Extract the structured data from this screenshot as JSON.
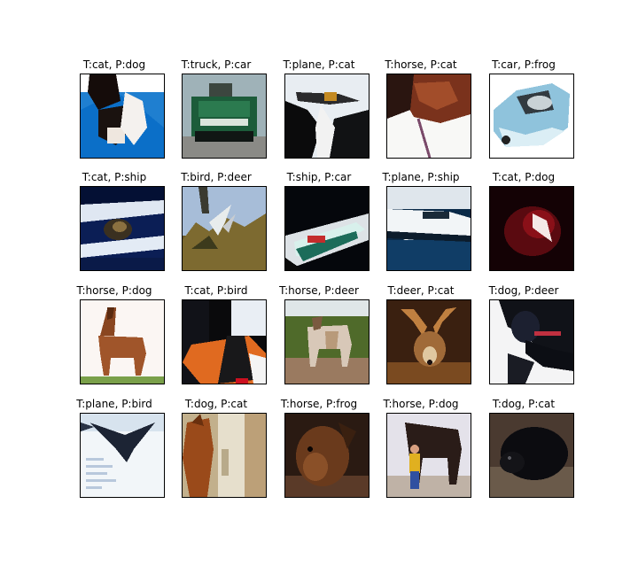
{
  "panels": [
    {
      "title": "T:cat, P:dog",
      "scene": "cat-blue-chair"
    },
    {
      "title": "T:truck, P:car",
      "scene": "green-truck"
    },
    {
      "title": "T:plane, P:cat",
      "scene": "plane-sky-dark"
    },
    {
      "title": "T:horse, P:cat",
      "scene": "horse-head-brown"
    },
    {
      "title": "T:car, P:frog",
      "scene": "light-blue-car"
    },
    {
      "title": "T:cat, P:ship",
      "scene": "cat-dark-blue"
    },
    {
      "title": "T:bird, P:deer",
      "scene": "bird-over-trees"
    },
    {
      "title": "T:ship, P:car",
      "scene": "boat-on-water"
    },
    {
      "title": "T:plane, P:ship",
      "scene": "white-ship-blue"
    },
    {
      "title": "T:cat, P:dog",
      "scene": "red-dark-blob"
    },
    {
      "title": "T:horse, P:dog",
      "scene": "brown-horse-white"
    },
    {
      "title": "T:cat, P:bird",
      "scene": "cat-orange-white"
    },
    {
      "title": "T:horse, P:deer",
      "scene": "horses-field"
    },
    {
      "title": "T:deer, P:cat",
      "scene": "deer-antlers"
    },
    {
      "title": "T:dog, P:deer",
      "scene": "black-dog-white"
    },
    {
      "title": "T:plane, P:bird",
      "scene": "plane-pale-sky"
    },
    {
      "title": "T:dog, P:cat",
      "scene": "dog-door"
    },
    {
      "title": "T:horse, P:frog",
      "scene": "horse-head-dark"
    },
    {
      "title": "T:horse, P:dog",
      "scene": "horse-person"
    },
    {
      "title": "T:dog, P:cat",
      "scene": "black-dog-dark"
    }
  ]
}
